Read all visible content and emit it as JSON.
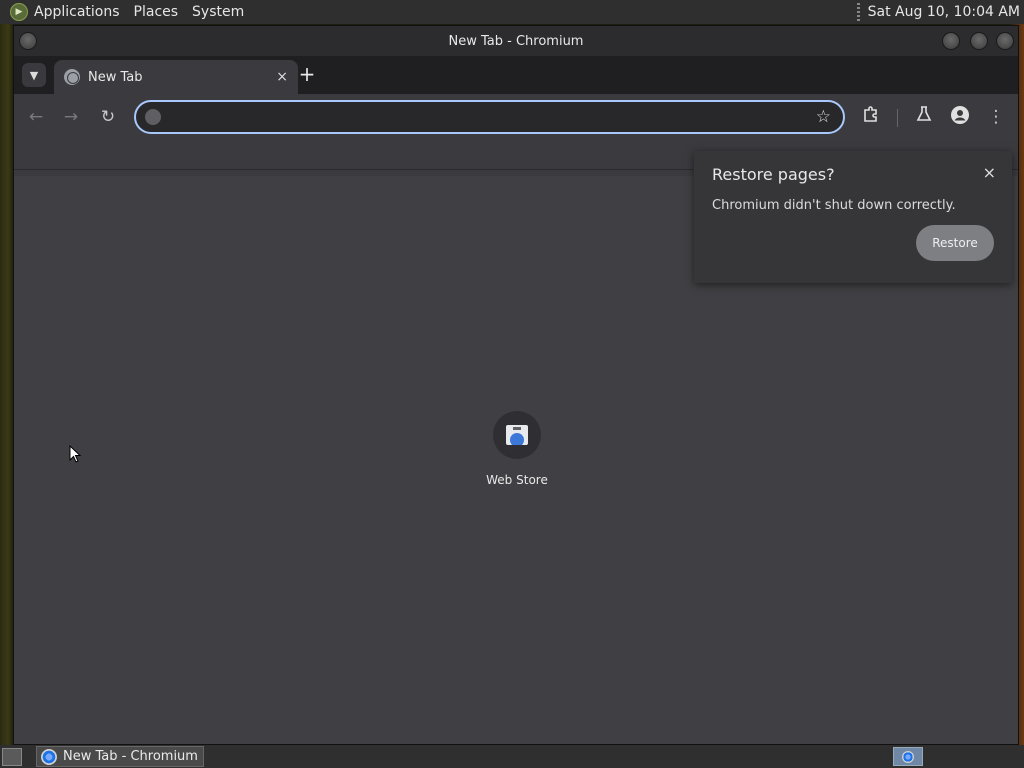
{
  "top_panel": {
    "menus": [
      "Applications",
      "Places",
      "System"
    ],
    "clock": "Sat Aug 10, 10:04 AM"
  },
  "window": {
    "title": "New Tab - Chromium"
  },
  "tabs": [
    {
      "label": "New Tab",
      "favicon": "globe-icon",
      "close": "×"
    }
  ],
  "new_tab_label": "+",
  "toolbar": {
    "back_icon": "←",
    "forward_icon": "→",
    "reload_icon": "↻",
    "omnibox_value": "",
    "bookmark_icon": "☆",
    "extensions_icon": "extensions-icon",
    "labs_icon": "labs-icon",
    "profile_icon": "profile-icon",
    "menu_icon": "⋮"
  },
  "shortcuts": [
    {
      "label": "Web Store",
      "icon": "web-store-icon"
    }
  ],
  "restore_bubble": {
    "title": "Restore pages?",
    "message": "Chromium didn't shut down correctly.",
    "button_label": "Restore",
    "close": "×"
  },
  "taskbar": {
    "task_label": "New Tab - Chromium"
  },
  "colors": {
    "accent": "#a8c7fa",
    "content_bg": "#404044",
    "toolbar_bg": "#3b3b3f"
  }
}
